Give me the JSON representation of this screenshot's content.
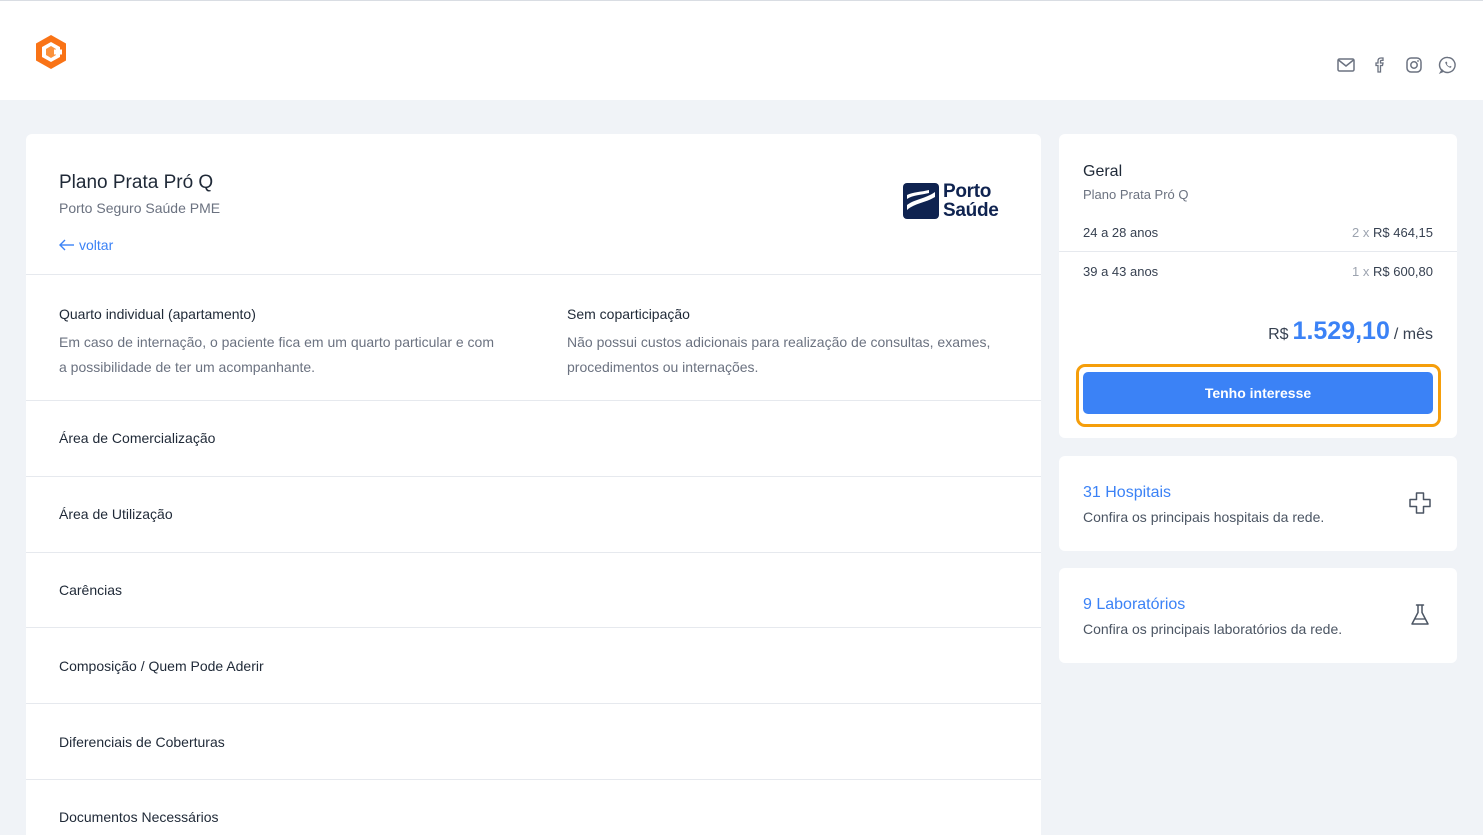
{
  "header": {
    "logo": "brand-logo",
    "social": [
      "mail-icon",
      "facebook-icon",
      "instagram-icon",
      "whatsapp-icon"
    ]
  },
  "plan": {
    "title": "Plano Prata Pró Q",
    "operator": "Porto Seguro Saúde PME",
    "back_label": "voltar",
    "brand_line1": "Porto",
    "brand_line2": "Saúde"
  },
  "features": [
    {
      "title": "Quarto individual (apartamento)",
      "text": "Em caso de internação, o paciente fica em um quarto particular e com a possibilidade de ter um acompanhante."
    },
    {
      "title": "Sem coparticipação",
      "text": "Não possui custos adicionais para realização de consultas, exames, procedimentos ou internações."
    }
  ],
  "accordion": [
    "Área de Comercialização",
    "Área de Utilização",
    "Carências",
    "Composição / Quem Pode Aderir",
    "Diferenciais de Coberturas",
    "Documentos Necessários"
  ],
  "summary": {
    "title": "Geral",
    "plan": "Plano Prata Pró Q",
    "rows": [
      {
        "age": "24 a 28 anos",
        "mult": "2 x",
        "price": "R$ 464,15"
      },
      {
        "age": "39 a 43 anos",
        "mult": "1 x",
        "price": "R$ 600,80"
      }
    ],
    "currency": "R$",
    "total": "1.529,10",
    "period": "/ mês",
    "cta": "Tenho interesse"
  },
  "network": {
    "hospitals_title": "31 Hospitais",
    "hospitals_text": "Confira os principais hospitais da rede.",
    "labs_title": "9 Laboratórios",
    "labs_text": "Confira os principais laboratórios da rede."
  },
  "colors": {
    "accent": "#3b82f6",
    "highlight": "#f59e0b",
    "logo": "#f97316",
    "brand": "#0f2350"
  }
}
